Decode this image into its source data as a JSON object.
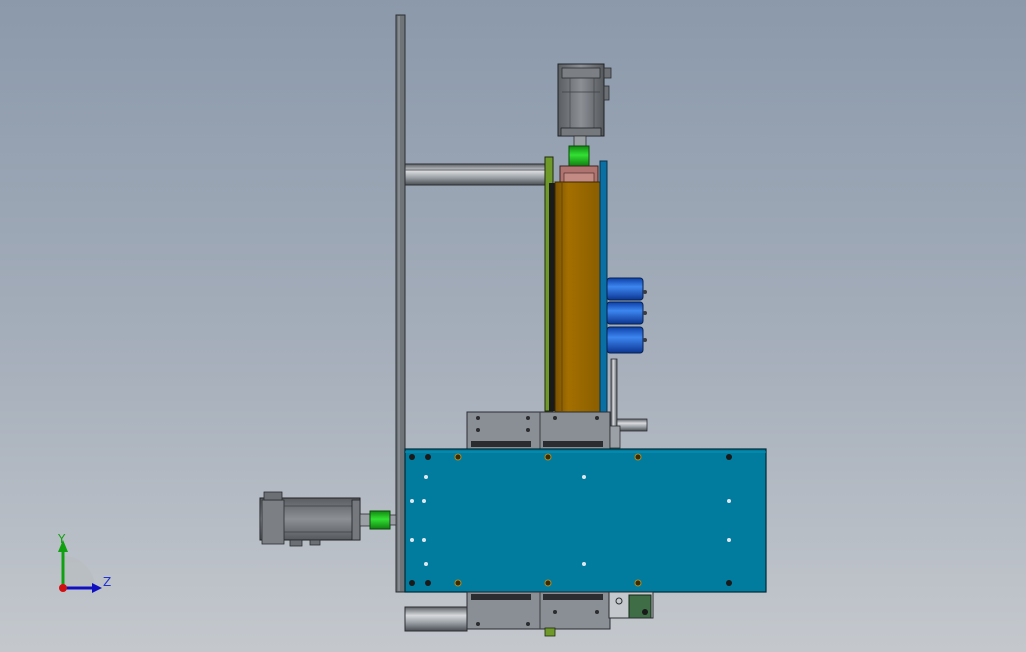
{
  "viewport": {
    "background_top": "#8b99ab",
    "background_bottom": "#c4c8cd"
  },
  "triad": {
    "y_label": "Y",
    "z_label": "Z",
    "x_color": "#d01010",
    "y_color": "#10a010",
    "z_color": "#1010c0"
  },
  "colors": {
    "plate_blue": "#017c9e",
    "column_brown": "#a36f00",
    "coupling_green": "#22cc22",
    "cylinder_blue": "#1a5fd0",
    "steel_gray": "#8a8f96",
    "motor_gray": "#6e7175"
  }
}
